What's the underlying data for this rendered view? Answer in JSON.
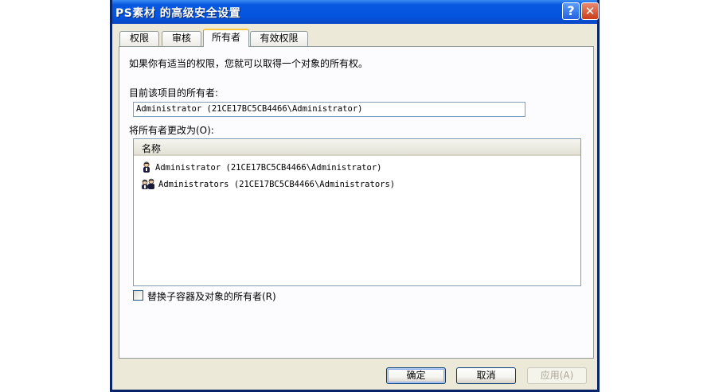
{
  "window": {
    "title": "PS素材 的高级安全设置"
  },
  "titlebar": {
    "help_label": "?",
    "close_label": "✕"
  },
  "tabs": [
    {
      "label": "权限"
    },
    {
      "label": "审核"
    },
    {
      "label": "所有者"
    },
    {
      "label": "有效权限"
    }
  ],
  "active_tab": "所有者",
  "owner_tab": {
    "description": "如果你有适当的权限，您就可以取得一个对象的所有权。",
    "current_owner_label": "目前该项目的所有者:",
    "current_owner_value": "Administrator (21CE17BC5CB4466\\Administrator)",
    "change_owner_label": "将所有者更改为(O):",
    "list_header": "名称",
    "owners": [
      {
        "name": "Administrator (21CE17BC5CB4466\\Administrator)",
        "icon": "user-icon"
      },
      {
        "name": "Administrators (21CE17BC5CB4466\\Administrators)",
        "icon": "group-icon"
      }
    ],
    "replace_checkbox_label": "替换子容器及对象的所有者(R)",
    "replace_checked": false
  },
  "buttons": {
    "ok": "确定",
    "cancel": "取消",
    "apply": "应用(A)"
  },
  "colors": {
    "titlebar": "#0554de",
    "dialog_bg": "#ece9d8",
    "active_tab_accent": "#ffc83c"
  }
}
